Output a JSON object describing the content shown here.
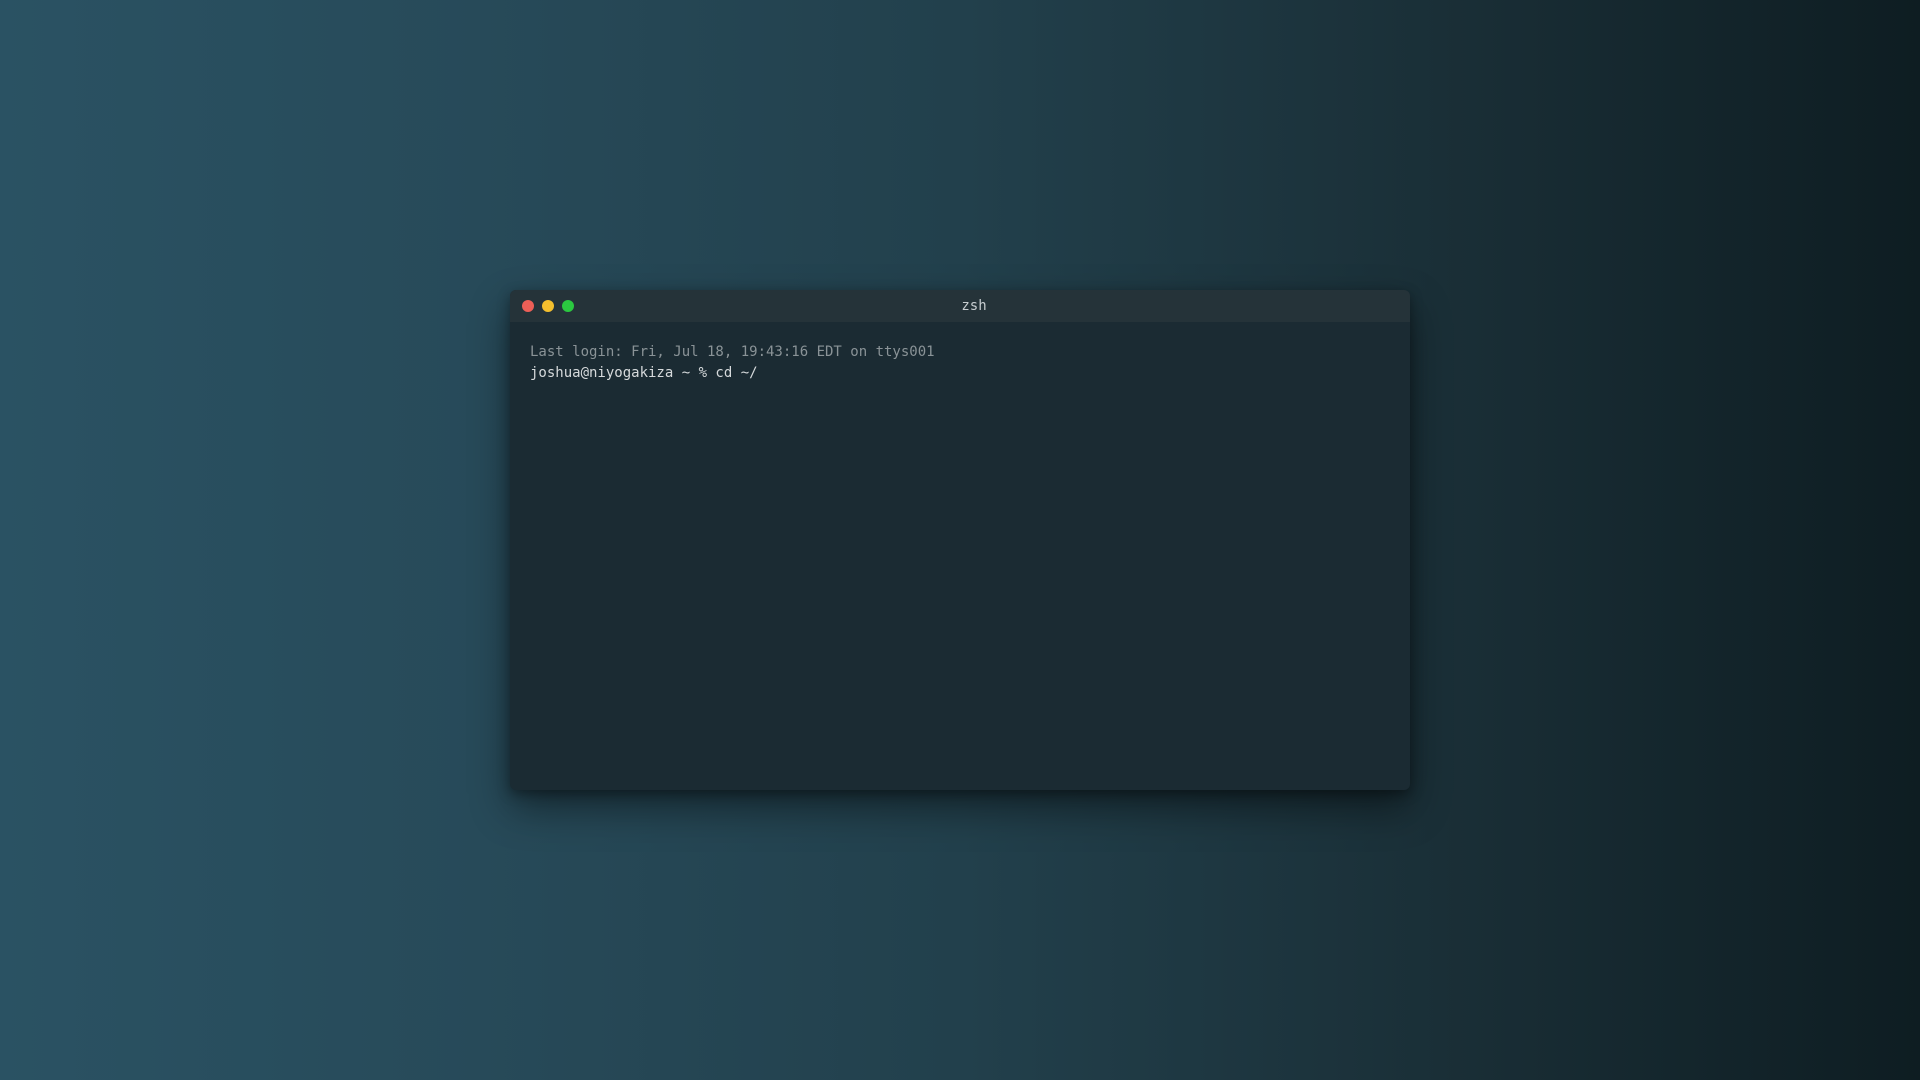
{
  "window": {
    "title": "zsh",
    "buttons": {
      "close_color": "#ed5f57",
      "minimize_color": "#f4bf2e",
      "maximize_color": "#2bc840"
    }
  },
  "terminal": {
    "lines": [
      "Last login: Fri, Jul 18, 19:43:16 EDT on ttys001",
      "joshua@niyogakiza ~ % cd ~/"
    ]
  }
}
